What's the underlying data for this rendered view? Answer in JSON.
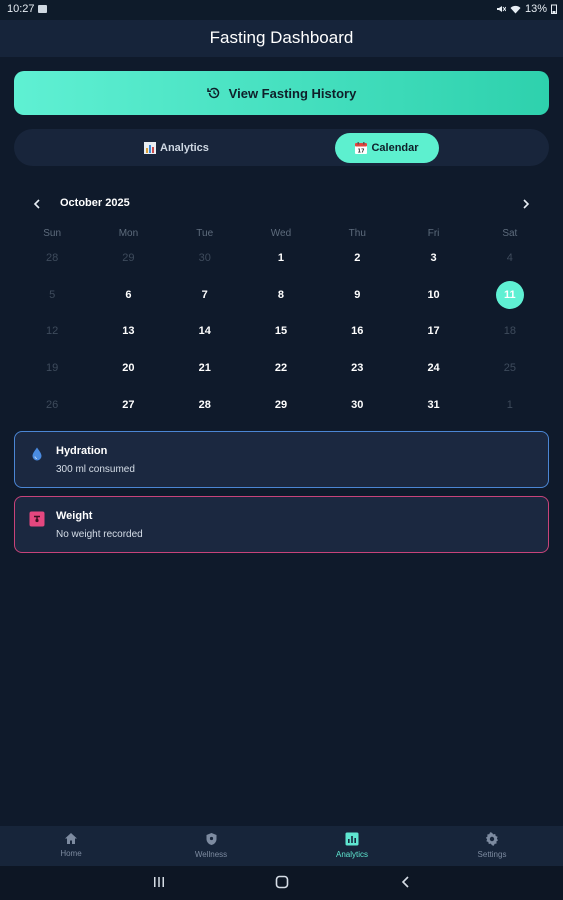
{
  "status_bar": {
    "time": "10:27",
    "battery": "13%"
  },
  "header": {
    "title": "Fasting Dashboard"
  },
  "history_button": {
    "label": "View Fasting History"
  },
  "tabs": [
    {
      "label": "Analytics",
      "icon": "bar-chart-icon",
      "active": false
    },
    {
      "label": "Calendar",
      "icon": "calendar-icon",
      "active": true
    }
  ],
  "calendar": {
    "month_label": "October 2025",
    "weekdays": [
      "Sun",
      "Mon",
      "Tue",
      "Wed",
      "Thu",
      "Fri",
      "Sat"
    ],
    "days": [
      {
        "d": "28",
        "muted": true
      },
      {
        "d": "29",
        "muted": true
      },
      {
        "d": "30",
        "muted": true
      },
      {
        "d": "1",
        "muted": false
      },
      {
        "d": "2",
        "muted": false
      },
      {
        "d": "3",
        "muted": false
      },
      {
        "d": "4",
        "muted": true
      },
      {
        "d": "5",
        "muted": true
      },
      {
        "d": "6",
        "muted": false
      },
      {
        "d": "7",
        "muted": false
      },
      {
        "d": "8",
        "muted": false
      },
      {
        "d": "9",
        "muted": false
      },
      {
        "d": "10",
        "muted": false
      },
      {
        "d": "11",
        "muted": false,
        "today": true
      },
      {
        "d": "12",
        "muted": true
      },
      {
        "d": "13",
        "muted": false
      },
      {
        "d": "14",
        "muted": false
      },
      {
        "d": "15",
        "muted": false
      },
      {
        "d": "16",
        "muted": false
      },
      {
        "d": "17",
        "muted": false
      },
      {
        "d": "18",
        "muted": true
      },
      {
        "d": "19",
        "muted": true
      },
      {
        "d": "20",
        "muted": false
      },
      {
        "d": "21",
        "muted": false
      },
      {
        "d": "22",
        "muted": false
      },
      {
        "d": "23",
        "muted": false
      },
      {
        "d": "24",
        "muted": false
      },
      {
        "d": "25",
        "muted": true
      },
      {
        "d": "26",
        "muted": true
      },
      {
        "d": "27",
        "muted": false
      },
      {
        "d": "28",
        "muted": false
      },
      {
        "d": "29",
        "muted": false
      },
      {
        "d": "30",
        "muted": false
      },
      {
        "d": "31",
        "muted": false
      },
      {
        "d": "1",
        "muted": true
      }
    ]
  },
  "cards": {
    "hydration": {
      "title": "Hydration",
      "subtitle": "300 ml consumed",
      "icon": "water-drop-icon",
      "color": "#4b86d4"
    },
    "weight": {
      "title": "Weight",
      "subtitle": "No weight recorded",
      "icon": "scale-icon",
      "color": "#c7437a"
    }
  },
  "bottom_nav": [
    {
      "label": "Home",
      "icon": "home-icon",
      "active": false
    },
    {
      "label": "Wellness",
      "icon": "shield-icon",
      "active": false
    },
    {
      "label": "Analytics",
      "icon": "analytics-icon",
      "active": true
    },
    {
      "label": "Settings",
      "icon": "gear-icon",
      "active": false
    }
  ],
  "colors": {
    "accent": "#5ff0d3",
    "background": "#0f1a2b",
    "hydration": "#4b86d4",
    "weight": "#c7437a"
  }
}
